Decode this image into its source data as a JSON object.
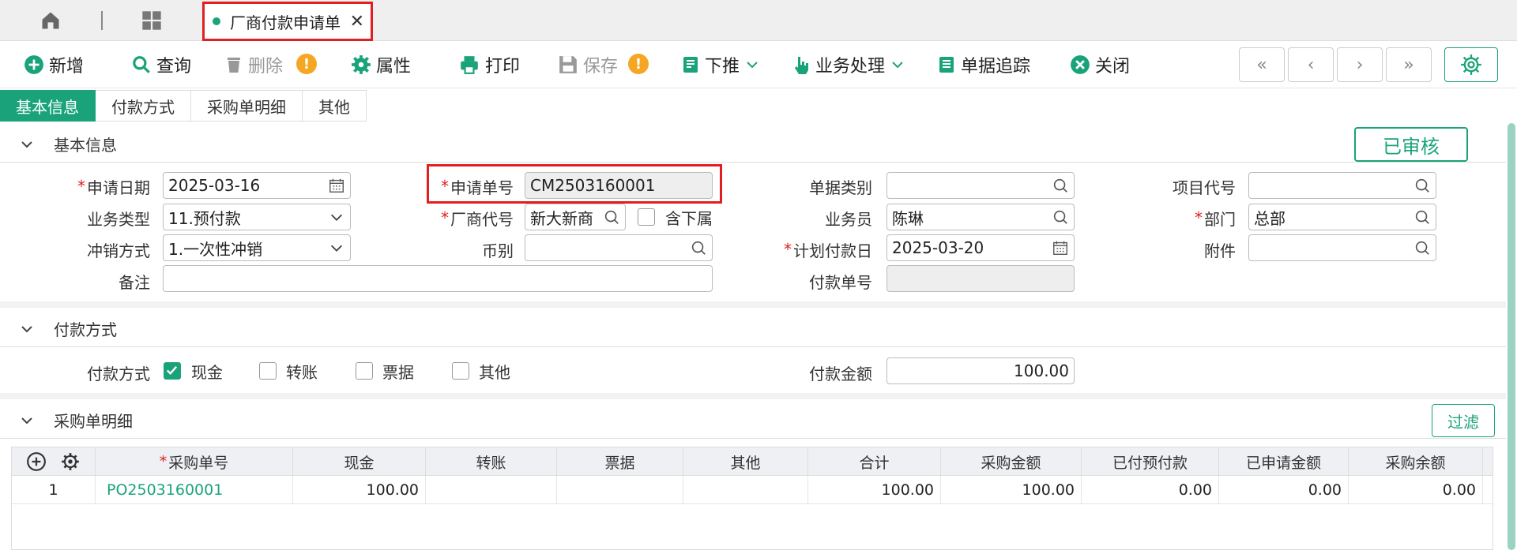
{
  "tabbar": {
    "doc_tab_label": "厂商付款申请单",
    "close_glyph": "✕"
  },
  "toolbar": {
    "add": "新增",
    "query": "查询",
    "delete": "删除",
    "properties": "属性",
    "print": "打印",
    "save": "保存",
    "push_down": "下推",
    "business": "业务处理",
    "trace": "单据追踪",
    "close": "关闭",
    "nav": [
      "«",
      "‹",
      "›",
      "»"
    ]
  },
  "section_tabs": [
    "基本信息",
    "付款方式",
    "采购单明细",
    "其他"
  ],
  "basic": {
    "title": "基本信息",
    "status": "已审核",
    "apply_date_label": "申请日期",
    "apply_date": "2025-03-16",
    "apply_no_label": "申请单号",
    "apply_no": "CM2503160001",
    "doc_type_label": "单据类别",
    "doc_type": "",
    "project_label": "项目代号",
    "project": "",
    "biz_type_label": "业务类型",
    "biz_type": "11.预付款",
    "vendor_label": "厂商代号",
    "vendor": "新大新商",
    "include_sub_label": "含下属",
    "salesman_label": "业务员",
    "salesman": "陈琳",
    "dept_label": "部门",
    "dept": "总部",
    "offset_label": "冲销方式",
    "offset": "1.一次性冲销",
    "currency_label": "币别",
    "currency": "",
    "plan_date_label": "计划付款日",
    "plan_date": "2025-03-20",
    "attach_label": "附件",
    "attach": "",
    "remark_label": "备注",
    "remark": "",
    "pay_no_label": "付款单号",
    "pay_no": ""
  },
  "payment": {
    "title": "付款方式",
    "method_label": "付款方式",
    "options": [
      {
        "label": "现金",
        "checked": true
      },
      {
        "label": "转账",
        "checked": false
      },
      {
        "label": "票据",
        "checked": false
      },
      {
        "label": "其他",
        "checked": false
      }
    ],
    "amount_label": "付款金额",
    "amount": "100.00"
  },
  "detail": {
    "title": "采购单明细",
    "filter": "过滤",
    "columns": [
      "采购单号",
      "现金",
      "转账",
      "票据",
      "其他",
      "合计",
      "采购金额",
      "已付预付款",
      "已申请金额",
      "采购余额"
    ],
    "rows": [
      {
        "no": "1",
        "po": "PO2503160001",
        "cash": "100.00",
        "transfer": "",
        "bill": "",
        "other": "",
        "total": "100.00",
        "purchase_amount": "100.00",
        "prepaid": "0.00",
        "applied": "0.00",
        "balance": "0.00"
      }
    ]
  },
  "colors": {
    "accent": "#1aa37a",
    "highlight": "#e02020",
    "warning": "#f5a623"
  }
}
